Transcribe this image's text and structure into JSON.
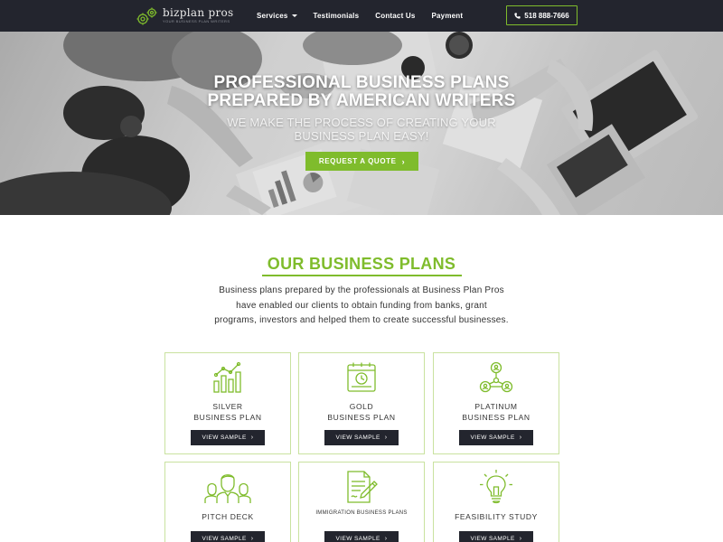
{
  "nav": {
    "logo_name": "bizplan pros",
    "logo_tagline": "your business plan writers",
    "menu": [
      {
        "label": "Services",
        "has_dropdown": true
      },
      {
        "label": "Testimonials",
        "has_dropdown": false
      },
      {
        "label": "Contact Us",
        "has_dropdown": false
      },
      {
        "label": "Payment",
        "has_dropdown": false
      }
    ],
    "phone": "518 888-7666",
    "phone_icon": "phone-icon"
  },
  "hero": {
    "title_line1": "PROFESSIONAL BUSINESS PLANS",
    "title_line2": "PREPARED BY AMERICAN WRITERS",
    "subtitle_line1": "WE MAKE THE PROCESS OF CREATING YOUR",
    "subtitle_line2": "BUSINESS PLAN EASY!",
    "cta_label": "REQUEST A QUOTE"
  },
  "plans_section": {
    "title": "OUR BUSINESS PLANS",
    "description_line1": "Business plans prepared by the professionals at Business Plan Pros",
    "description_line2": "have enabled our clients to obtain funding from banks, grant",
    "description_line3": "programs, investors and helped them to create successful businesses.",
    "cards": [
      {
        "line1": "SILVER",
        "line2": "BUSINESS PLAN",
        "icon": "bar-chart-icon",
        "button": "VIEW SAMPLE"
      },
      {
        "line1": "GOLD",
        "line2": "BUSINESS PLAN",
        "icon": "calendar-clock-icon",
        "button": "VIEW SAMPLE"
      },
      {
        "line1": "PLATINUM",
        "line2": "BUSINESS PLAN",
        "icon": "network-people-icon",
        "button": "VIEW SAMPLE"
      },
      {
        "line1": "PITCH DECK",
        "line2": "",
        "icon": "team-icon",
        "button": "VIEW SAMPLE"
      },
      {
        "line1": "IMMIGRATION BUSINESS PLANS",
        "line2": "",
        "icon": "document-pen-icon",
        "button": "VIEW SAMPLE"
      },
      {
        "line1": "FEASIBILITY STUDY",
        "line2": "",
        "icon": "lightbulb-icon",
        "button": "VIEW SAMPLE"
      }
    ]
  },
  "colors": {
    "accent": "#7fbc2c",
    "nav_bg": "#23252e",
    "button_dark": "#23252e",
    "card_border": "#c9e29f"
  }
}
